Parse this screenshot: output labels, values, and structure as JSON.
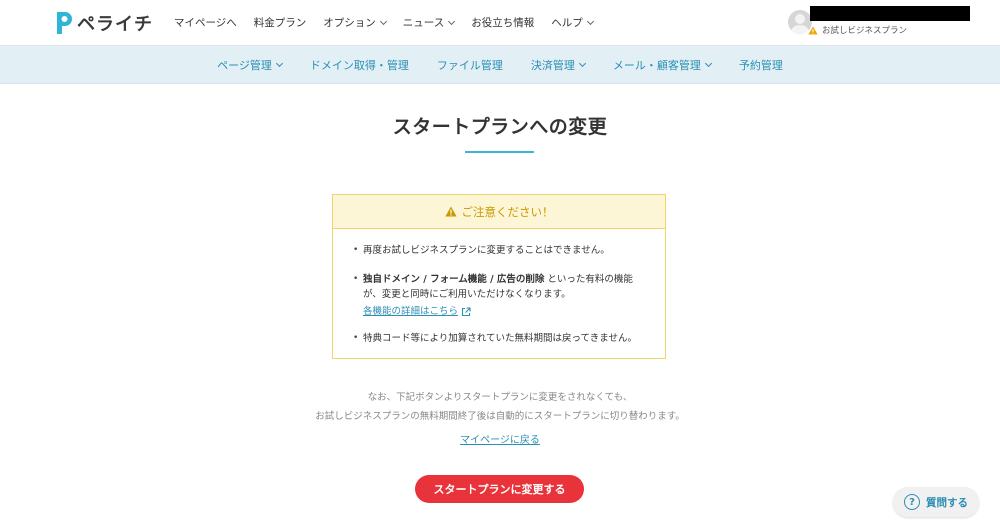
{
  "header": {
    "logo_text": "ペライチ",
    "nav": [
      {
        "label": "マイページへ",
        "dropdown": false
      },
      {
        "label": "料金プラン",
        "dropdown": false
      },
      {
        "label": "オプション",
        "dropdown": true
      },
      {
        "label": "ニュース",
        "dropdown": true
      },
      {
        "label": "お役立ち情報",
        "dropdown": false
      },
      {
        "label": "ヘルプ",
        "dropdown": true
      }
    ],
    "user": {
      "plan_status": "お試しビジネスプラン"
    }
  },
  "subnav": [
    {
      "label": "ページ管理",
      "dropdown": true
    },
    {
      "label": "ドメイン取得・管理",
      "dropdown": false
    },
    {
      "label": "ファイル管理",
      "dropdown": false
    },
    {
      "label": "決済管理",
      "dropdown": true
    },
    {
      "label": "メール・顧客管理",
      "dropdown": true
    },
    {
      "label": "予約管理",
      "dropdown": false
    }
  ],
  "main": {
    "title": "スタートプランへの変更",
    "notice": {
      "heading": "ご注意ください！",
      "item1": "再度お試しビジネスプランに変更することはできません。",
      "item2_bold": "独自ドメイン / フォーム機能 / 広告の削除",
      "item2_rest": " といった有料の機能が、変更と同時にご利用いただけなくなります。",
      "item2_link": "各機能の詳細はこちら",
      "item3": "特典コード等により加算されていた無料期間は戻ってきません。"
    },
    "note_line1": "なお、下記ボタンよりスタートプランに変更をされなくても、",
    "note_line2": "お試しビジネスプランの無料期間終了後は自動的にスタートプランに切り替わります。",
    "back_link": "マイページに戻る",
    "cta": "スタートプランに変更する"
  },
  "help": {
    "icon": "?",
    "label": "質問する"
  },
  "colors": {
    "brand_blue": "#2b8eb3",
    "accent_cyan": "#3fb5d6",
    "cta_red": "#e8333a",
    "warning_yellow": "#f0d36a"
  }
}
